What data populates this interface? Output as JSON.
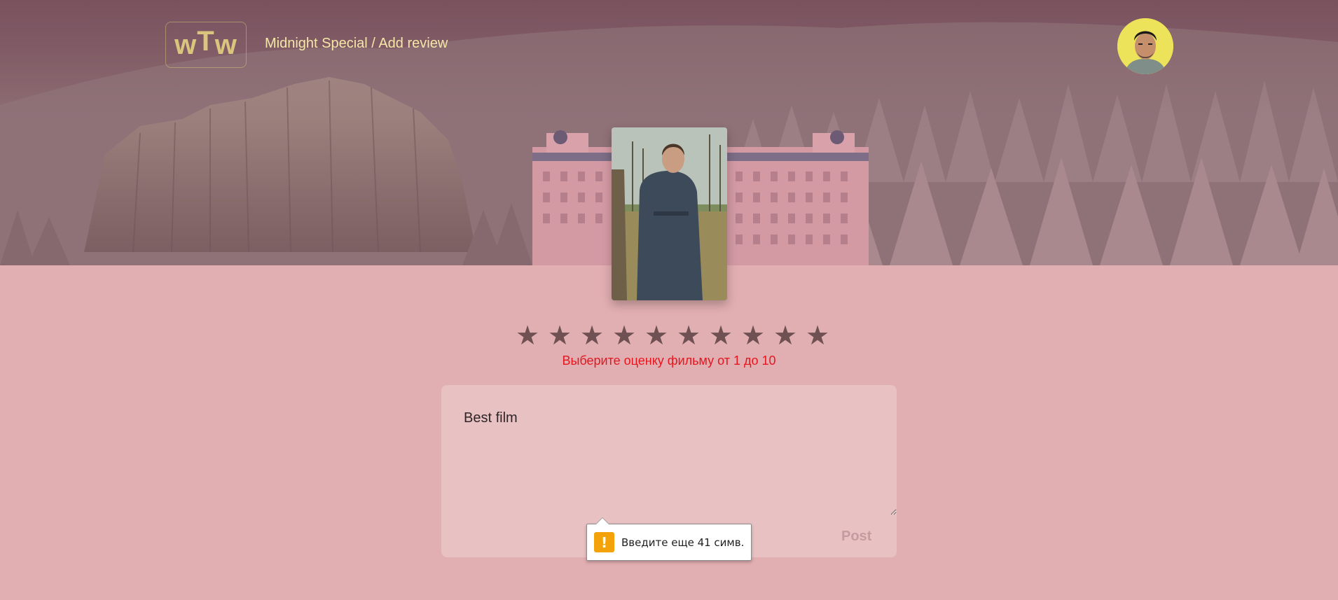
{
  "header": {
    "logo": {
      "letters": [
        "w",
        "T",
        "w"
      ]
    },
    "breadcrumb": {
      "movie_title": "Midnight Special",
      "separator": " / ",
      "current": "Add review"
    },
    "avatar_icon": "user-avatar-icon"
  },
  "poster_icon": "movie-poster-image",
  "rating": {
    "stars": [
      "★",
      "★",
      "★",
      "★",
      "★",
      "★",
      "★",
      "★",
      "★",
      "★"
    ],
    "star_color": "#6f5153",
    "error_text": "Выберите оценку фильму от 1 до 10",
    "error_color": "#e6161f"
  },
  "review": {
    "text": "Best film",
    "post_label": "Post"
  },
  "validation_tooltip": {
    "icon": "warning-icon",
    "icon_glyph": "!",
    "message": "Введите еще 41 симв."
  },
  "colors": {
    "background": "#e1aeb1",
    "review_box": "#e8c1c3",
    "accent_text": "#f5e7a8",
    "post_disabled": "#c49b9f"
  }
}
